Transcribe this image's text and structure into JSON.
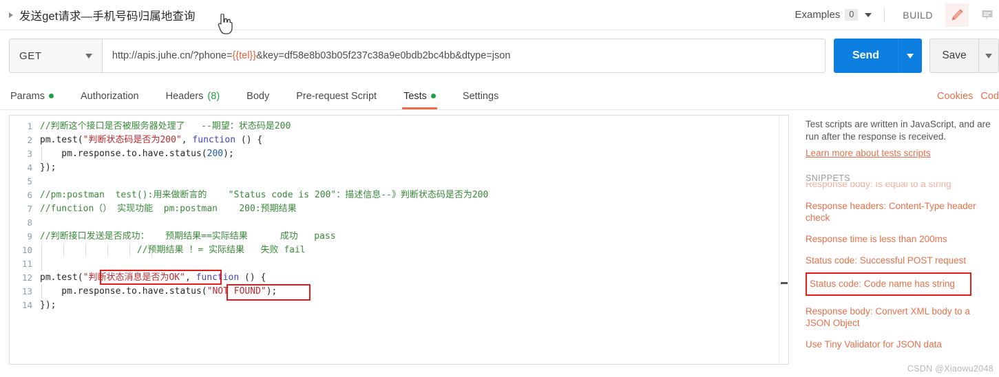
{
  "topbar": {
    "collapse_icon": "triangle-right-icon",
    "title": "发送get请求—手机号码归属地查询",
    "examples_label": "Examples",
    "examples_count": "0",
    "examples_caret": "chevron-down-icon",
    "build_label": "BUILD",
    "edit_icon": "pencil-icon",
    "comment_icon": "comment-icon"
  },
  "request": {
    "method": "GET",
    "method_caret": "chevron-down-icon",
    "url_prefix": "http://apis.juhe.cn/?phone=",
    "url_variable": "{{tel}}",
    "url_suffix": "&key=df58e8b03b05f237c38a9e0bdb2bc4bb&dtype=json",
    "url_full": "http://apis.juhe.cn/?phone={{tel}}&key=df58e8b03b05f237c38a9e0bdb2bc4bb&dtype=json",
    "send_label": "Send",
    "send_caret": "chevron-down-icon",
    "save_label": "Save",
    "save_caret": "chevron-down-icon",
    "accent_blue": "#0d7fe0"
  },
  "tabs": {
    "items": [
      {
        "label": "Params",
        "badge": "",
        "dot": true,
        "active": false
      },
      {
        "label": "Authorization",
        "badge": "",
        "dot": false,
        "active": false
      },
      {
        "label": "Headers",
        "badge": "(8)",
        "dot": false,
        "active": false
      },
      {
        "label": "Body",
        "badge": "",
        "dot": false,
        "active": false
      },
      {
        "label": "Pre-request Script",
        "badge": "",
        "dot": false,
        "active": false
      },
      {
        "label": "Tests",
        "badge": "",
        "dot": true,
        "active": true
      },
      {
        "label": "Settings",
        "badge": "",
        "dot": false,
        "active": false
      }
    ],
    "right_links": [
      "Cookies",
      "Cod"
    ],
    "active_underline_color": "#ef7044",
    "dot_color": "#1ea148"
  },
  "editor": {
    "lines": [
      {
        "n": "1",
        "text": "//判断这个接口是否被服务器处理了   --期望：状态码是200"
      },
      {
        "n": "2",
        "text": "pm.test(\"判断状态码是否为200\", function () {"
      },
      {
        "n": "3",
        "text": "    pm.response.to.have.status(200);"
      },
      {
        "n": "4",
        "text": "});"
      },
      {
        "n": "5",
        "text": ""
      },
      {
        "n": "6",
        "text": "//pm:postman  test():用来做断言的    \"Status code is 200\"：描述信息--》判断状态码是否为200"
      },
      {
        "n": "7",
        "text": "//function（） 实现功能  pm:postman    200:预期结果"
      },
      {
        "n": "8",
        "text": ""
      },
      {
        "n": "9",
        "text": "//判断接口发送是否成功：   预期结果==实际结果      成功   pass"
      },
      {
        "n": "10",
        "text": "                  //预期结果 ！= 实际结果   失败 fail"
      },
      {
        "n": "11",
        "text": ""
      },
      {
        "n": "12",
        "text": "pm.test(\"判断状态消息是否为OK\", function () {"
      },
      {
        "n": "13",
        "text": "    pm.response.to.have.status(\"NOT FOUND\");"
      },
      {
        "n": "14",
        "text": "});"
      }
    ],
    "highlight_boxes": [
      {
        "name": "test-name-string-highlight",
        "line": "12"
      },
      {
        "name": "status-argument-highlight",
        "line": "13"
      }
    ],
    "colors": {
      "comment": "#3a8a3a",
      "string": "#c02a32",
      "keyword": "#4141c8",
      "number": "#1a56c4",
      "plain": "#24292e",
      "line_number": "#8aa0ad",
      "highlight_box": "#e81b1b"
    }
  },
  "right_panel": {
    "description": "Test scripts are written in JavaScript, and are run after the response is received.",
    "learn_more": "Learn more about tests scripts",
    "snippets_header": "SNIPPETS",
    "snippets": [
      {
        "label": "Response body: Is equal to a string",
        "clipped": true,
        "boxed": false
      },
      {
        "label": "Response headers: Content-Type header check",
        "clipped": false,
        "boxed": false
      },
      {
        "label": "Response time is less than 200ms",
        "clipped": false,
        "boxed": false
      },
      {
        "label": "Status code: Successful POST request",
        "clipped": false,
        "boxed": false
      },
      {
        "label": "Status code: Code name has string",
        "clipped": false,
        "boxed": true
      },
      {
        "label": "Response body: Convert XML body to a JSON Object",
        "clipped": false,
        "boxed": false
      },
      {
        "label": "Use Tiny Validator for JSON data",
        "clipped": false,
        "boxed": false
      }
    ],
    "link_color": "#e8704a"
  },
  "watermark": "CSDN @Xiaowu2048"
}
